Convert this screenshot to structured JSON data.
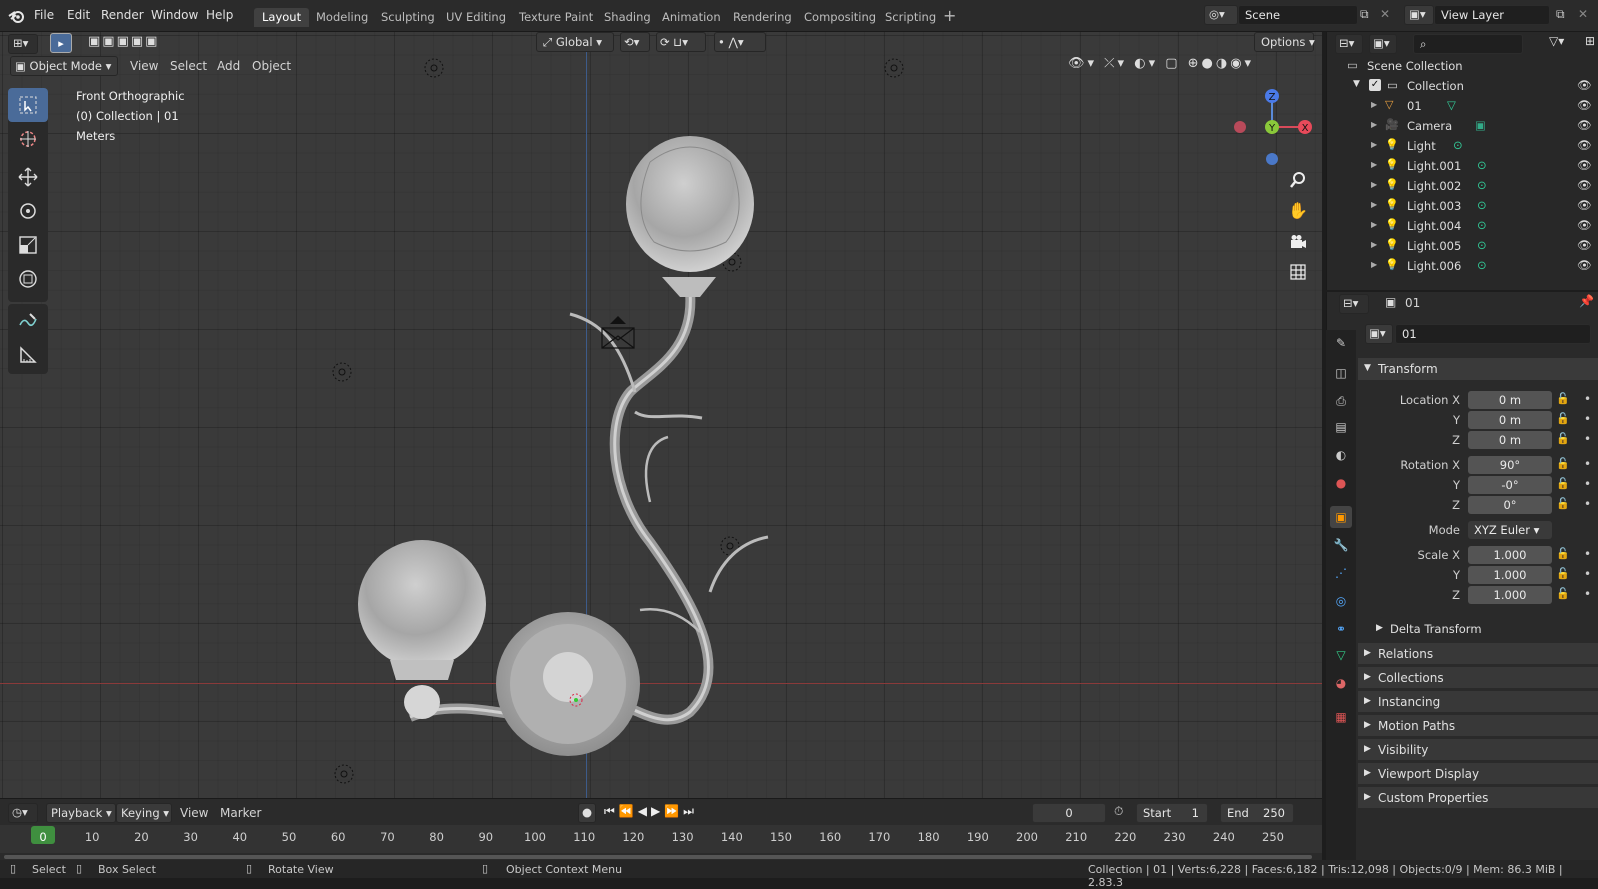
{
  "menu": [
    "File",
    "Edit",
    "Render",
    "Window",
    "Help"
  ],
  "workspaces": [
    "Layout",
    "Modeling",
    "Sculpting",
    "UV Editing",
    "Texture Paint",
    "Shading",
    "Animation",
    "Rendering",
    "Compositing",
    "Scripting"
  ],
  "scene": {
    "name": "Scene",
    "view_layer": "View Layer"
  },
  "header": {
    "mode": "Object Mode",
    "view": "View",
    "select": "Select",
    "add": "Add",
    "object": "Object",
    "orientation": "Global",
    "options": "Options"
  },
  "viewport": {
    "view_name": "Front Orthographic",
    "collection": "(0) Collection | 01",
    "units": "Meters"
  },
  "gizmo": {
    "z": "Z",
    "y": "Y",
    "x": "X"
  },
  "outliner": {
    "root": "Scene Collection",
    "collection": "Collection",
    "items": [
      "01",
      "Camera",
      "Light",
      "Light.001",
      "Light.002",
      "Light.003",
      "Light.004",
      "Light.005",
      "Light.006"
    ]
  },
  "properties": {
    "object_name": "01",
    "data_name": "01",
    "transform": "Transform",
    "location_label": "Location X",
    "rotation_label": "Rotation X",
    "scale_label": "Scale X",
    "y": "Y",
    "z": "Z",
    "location": [
      "0 m",
      "0 m",
      "0 m"
    ],
    "rotation": [
      "90°",
      "-0°",
      "0°"
    ],
    "mode_label": "Mode",
    "mode": "XYZ Euler",
    "scale": [
      "1.000",
      "1.000",
      "1.000"
    ],
    "delta": "Delta Transform",
    "panels": [
      "Relations",
      "Collections",
      "Instancing",
      "Motion Paths",
      "Visibility",
      "Viewport Display",
      "Custom Properties"
    ]
  },
  "timeline": {
    "playback": "Playback",
    "keying": "Keying",
    "view": "View",
    "marker": "Marker",
    "current": "0",
    "start_label": "Start",
    "start": "1",
    "end_label": "End",
    "end": "250",
    "frames": [
      "0",
      "10",
      "20",
      "30",
      "40",
      "50",
      "60",
      "70",
      "80",
      "90",
      "100",
      "110",
      "120",
      "130",
      "140",
      "150",
      "160",
      "170",
      "180",
      "190",
      "200",
      "210",
      "220",
      "230",
      "240",
      "250"
    ]
  },
  "status": {
    "select": "Select",
    "box": "Box Select",
    "rotate": "Rotate View",
    "context": "Object Context Menu",
    "stats": "Collection | 01 | Verts:6,228 | Faces:6,182 | Tris:12,098 | Objects:0/9 | Mem: 86.3 MiB | 2.83.3"
  }
}
